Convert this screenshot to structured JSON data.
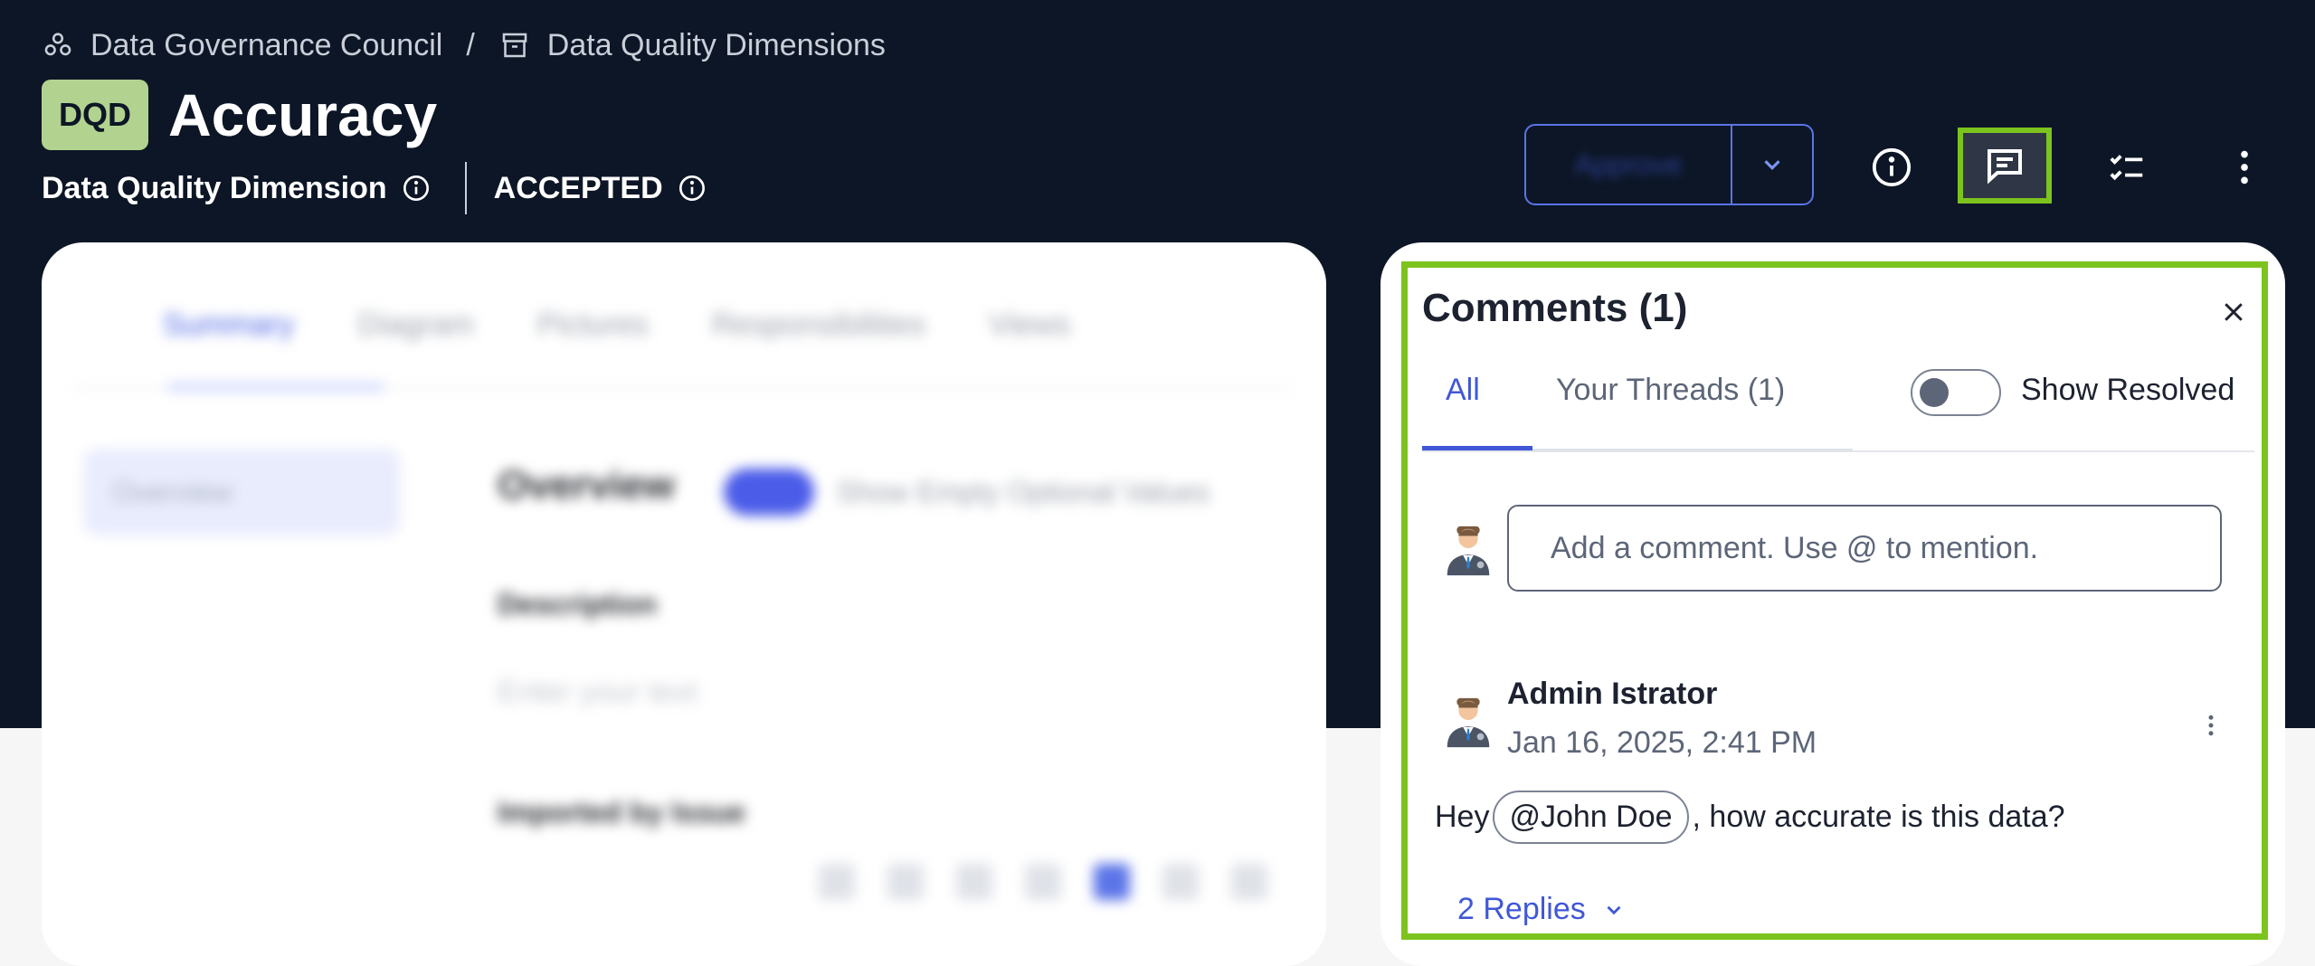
{
  "breadcrumb": {
    "items": [
      {
        "label": "Data Governance Council",
        "icon": "community-icon"
      },
      {
        "label": "Data Quality Dimensions",
        "icon": "domain-box-icon"
      }
    ],
    "separator": "/"
  },
  "asset": {
    "badge": "DQD",
    "title": "Accuracy",
    "type_label": "Data Quality Dimension",
    "status": "ACCEPTED"
  },
  "header_actions": {
    "primary_action_label": "Approve",
    "icons": [
      "info-icon",
      "comments-icon",
      "tasks-icon",
      "more-vertical-icon"
    ]
  },
  "main": {
    "tabs": [
      "Summary",
      "Diagram",
      "Pictures",
      "Responsibilities",
      "Views"
    ],
    "side_nav": [
      "Overview"
    ],
    "section_title": "Overview",
    "toggle_label": "Show Empty Optional Values",
    "description_label": "Description",
    "description_placeholder": "Enter your text",
    "imported_label": "Imported by Issue"
  },
  "comments": {
    "title": "Comments (1)",
    "tabs": {
      "all": "All",
      "threads": "Your Threads (1)"
    },
    "show_resolved_label": "Show Resolved",
    "show_resolved_on": false,
    "input_placeholder": "Add a comment. Use @ to mention.",
    "items": [
      {
        "author": "Admin Istrator",
        "date": "Jan 16, 2025, 2:41 PM",
        "body_prefix": "Hey",
        "mention": "@John Doe",
        "body_suffix": ", how accurate is this data?",
        "replies": "2 Replies"
      }
    ]
  },
  "colors": {
    "header_bg": "#0c1626",
    "accent": "#4057d8",
    "highlight": "#7cc31d",
    "badge_bg": "#b2d38f"
  }
}
